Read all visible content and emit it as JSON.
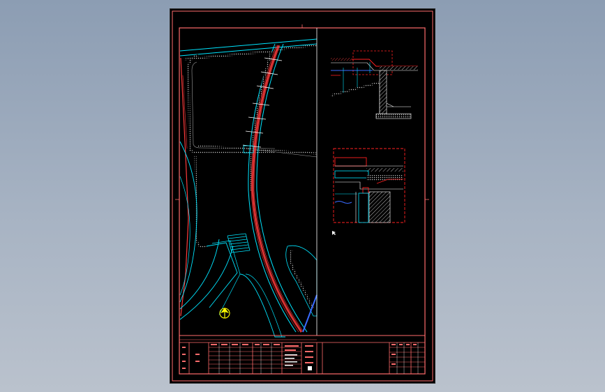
{
  "viewer": {
    "background_top": "#8c9db3",
    "background_bottom": "#bac2cd"
  },
  "drawing": {
    "sheet_color": "#000000",
    "border_color": "#ff6b6b",
    "road_color": "#00e5ff",
    "path_color": "#ff3b3b",
    "section_color": "#ff2020",
    "north_arrow_color": "#ffff00",
    "north_arrow_icon": "north-arrow-icon",
    "detail_marker_icon": "cursor-icon"
  }
}
